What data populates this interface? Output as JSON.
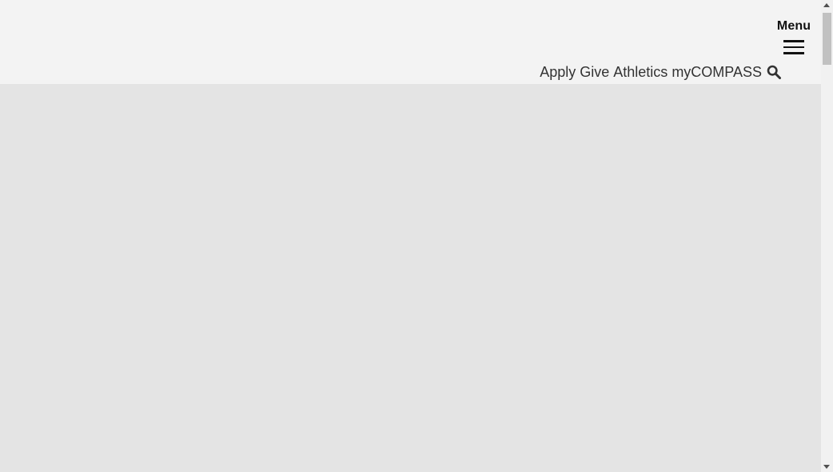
{
  "header": {
    "menu_label": "Menu",
    "menu_icon": "hamburger-icon",
    "utility_links": [
      {
        "label": "Apply"
      },
      {
        "label": "Give"
      },
      {
        "label": "Athletics"
      },
      {
        "label": "myCOMPASS"
      }
    ],
    "search_icon": "search-icon"
  },
  "colors": {
    "header_bg": "#f3f3f3",
    "hero_bg": "#e4e4e4",
    "text": "#333333",
    "menu_text": "#111111",
    "scrollbar_track": "#f1f1f1",
    "scrollbar_thumb": "#c1c1c1"
  }
}
